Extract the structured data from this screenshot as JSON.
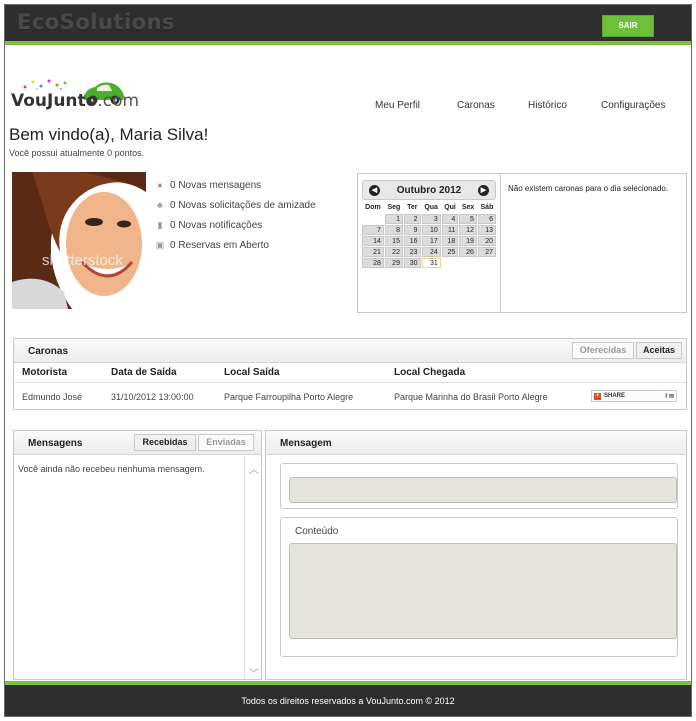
{
  "header": {
    "brand": "EcoSolutions",
    "logout_label": "SAIR"
  },
  "logo": {
    "main": "VouJunto",
    "suffix": ".com"
  },
  "nav": [
    "Meu Perfil",
    "Caronas",
    "Histórico",
    "Configurações"
  ],
  "welcome": {
    "greeting": "Bem vindo(a), Maria Silva!",
    "points": "Você possui atualmente 0 pontos."
  },
  "photo": {
    "watermark": "shutterstock"
  },
  "stats": {
    "messages": "0 Novas mensagens",
    "friend_requests": "0 Novas solicitações de amizade",
    "notifications": "0 Novas notificações",
    "reservations": "0 Reservas em Aberto"
  },
  "calendar": {
    "month_label": "Outubro 2012",
    "weekdays": [
      "Dom",
      "Seg",
      "Ter",
      "Qua",
      "Qui",
      "Sex",
      "Sáb"
    ],
    "weeks": [
      [
        "",
        "1",
        "2",
        "3",
        "4",
        "5",
        "6"
      ],
      [
        "7",
        "8",
        "9",
        "10",
        "11",
        "12",
        "13"
      ],
      [
        "14",
        "15",
        "16",
        "17",
        "18",
        "19",
        "20"
      ],
      [
        "21",
        "22",
        "23",
        "24",
        "25",
        "26",
        "27"
      ],
      [
        "28",
        "29",
        "30",
        "31",
        "",
        "",
        ""
      ]
    ],
    "highlighted_day": "31",
    "empty_message": "Não existem caronas para o dia selecionado."
  },
  "caronas": {
    "title": "Caronas",
    "tabs": [
      "Oferecidas",
      "Aceitas"
    ],
    "columns": [
      "Motorista",
      "Data de Saída",
      "Local Saída",
      "Local Chegada"
    ],
    "rows": [
      [
        "Edmundo José",
        "31/10/2012 13:00:00",
        "Parque Farroupilha Porto Alegre",
        "Parque Marinha do Brasil Porto Alegre"
      ]
    ],
    "share_label": "SHARE"
  },
  "mensagens": {
    "title": "Mensagens",
    "tabs": [
      "Recebidas",
      "Enviadas"
    ],
    "empty": "Você ainda não recebeu nenhuma mensagem."
  },
  "mensagem": {
    "title": "Mensagem",
    "content_label": "Conteúdo"
  },
  "footer": {
    "text": "Todos os direitos reservados a VouJunto.com © 2012"
  }
}
